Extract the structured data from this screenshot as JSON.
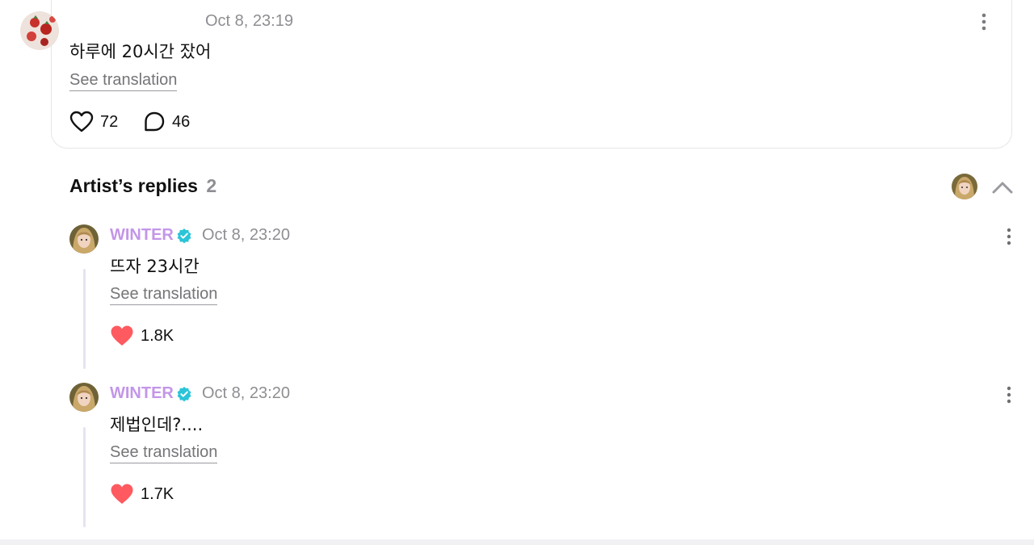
{
  "post": {
    "timestamp": "Oct 8, 23:19",
    "text": "하루에 20시간 잤어",
    "see_translation": "See translation",
    "likes": "72",
    "comments": "46"
  },
  "replies_section": {
    "title": "Artist’s replies",
    "count": "2"
  },
  "replies": [
    {
      "name": "WINTER",
      "time": "Oct 8, 23:20",
      "text": "뜨자 23시간",
      "see_translation": "See translation",
      "likes": "1.8K"
    },
    {
      "name": "WINTER",
      "time": "Oct 8, 23:20",
      "text": "제법인데?....",
      "see_translation": "See translation",
      "likes": "1.7K"
    }
  ],
  "colors": {
    "artist_name": "#c396e8",
    "verified": "#2bc4d8",
    "liked_heart": "#ff5a5f",
    "muted": "#8e8e93"
  },
  "icons": [
    "heart-outline-icon",
    "comment-bubble-icon",
    "more-vertical-icon",
    "chevron-up-icon",
    "verified-badge-icon",
    "heart-filled-icon"
  ]
}
